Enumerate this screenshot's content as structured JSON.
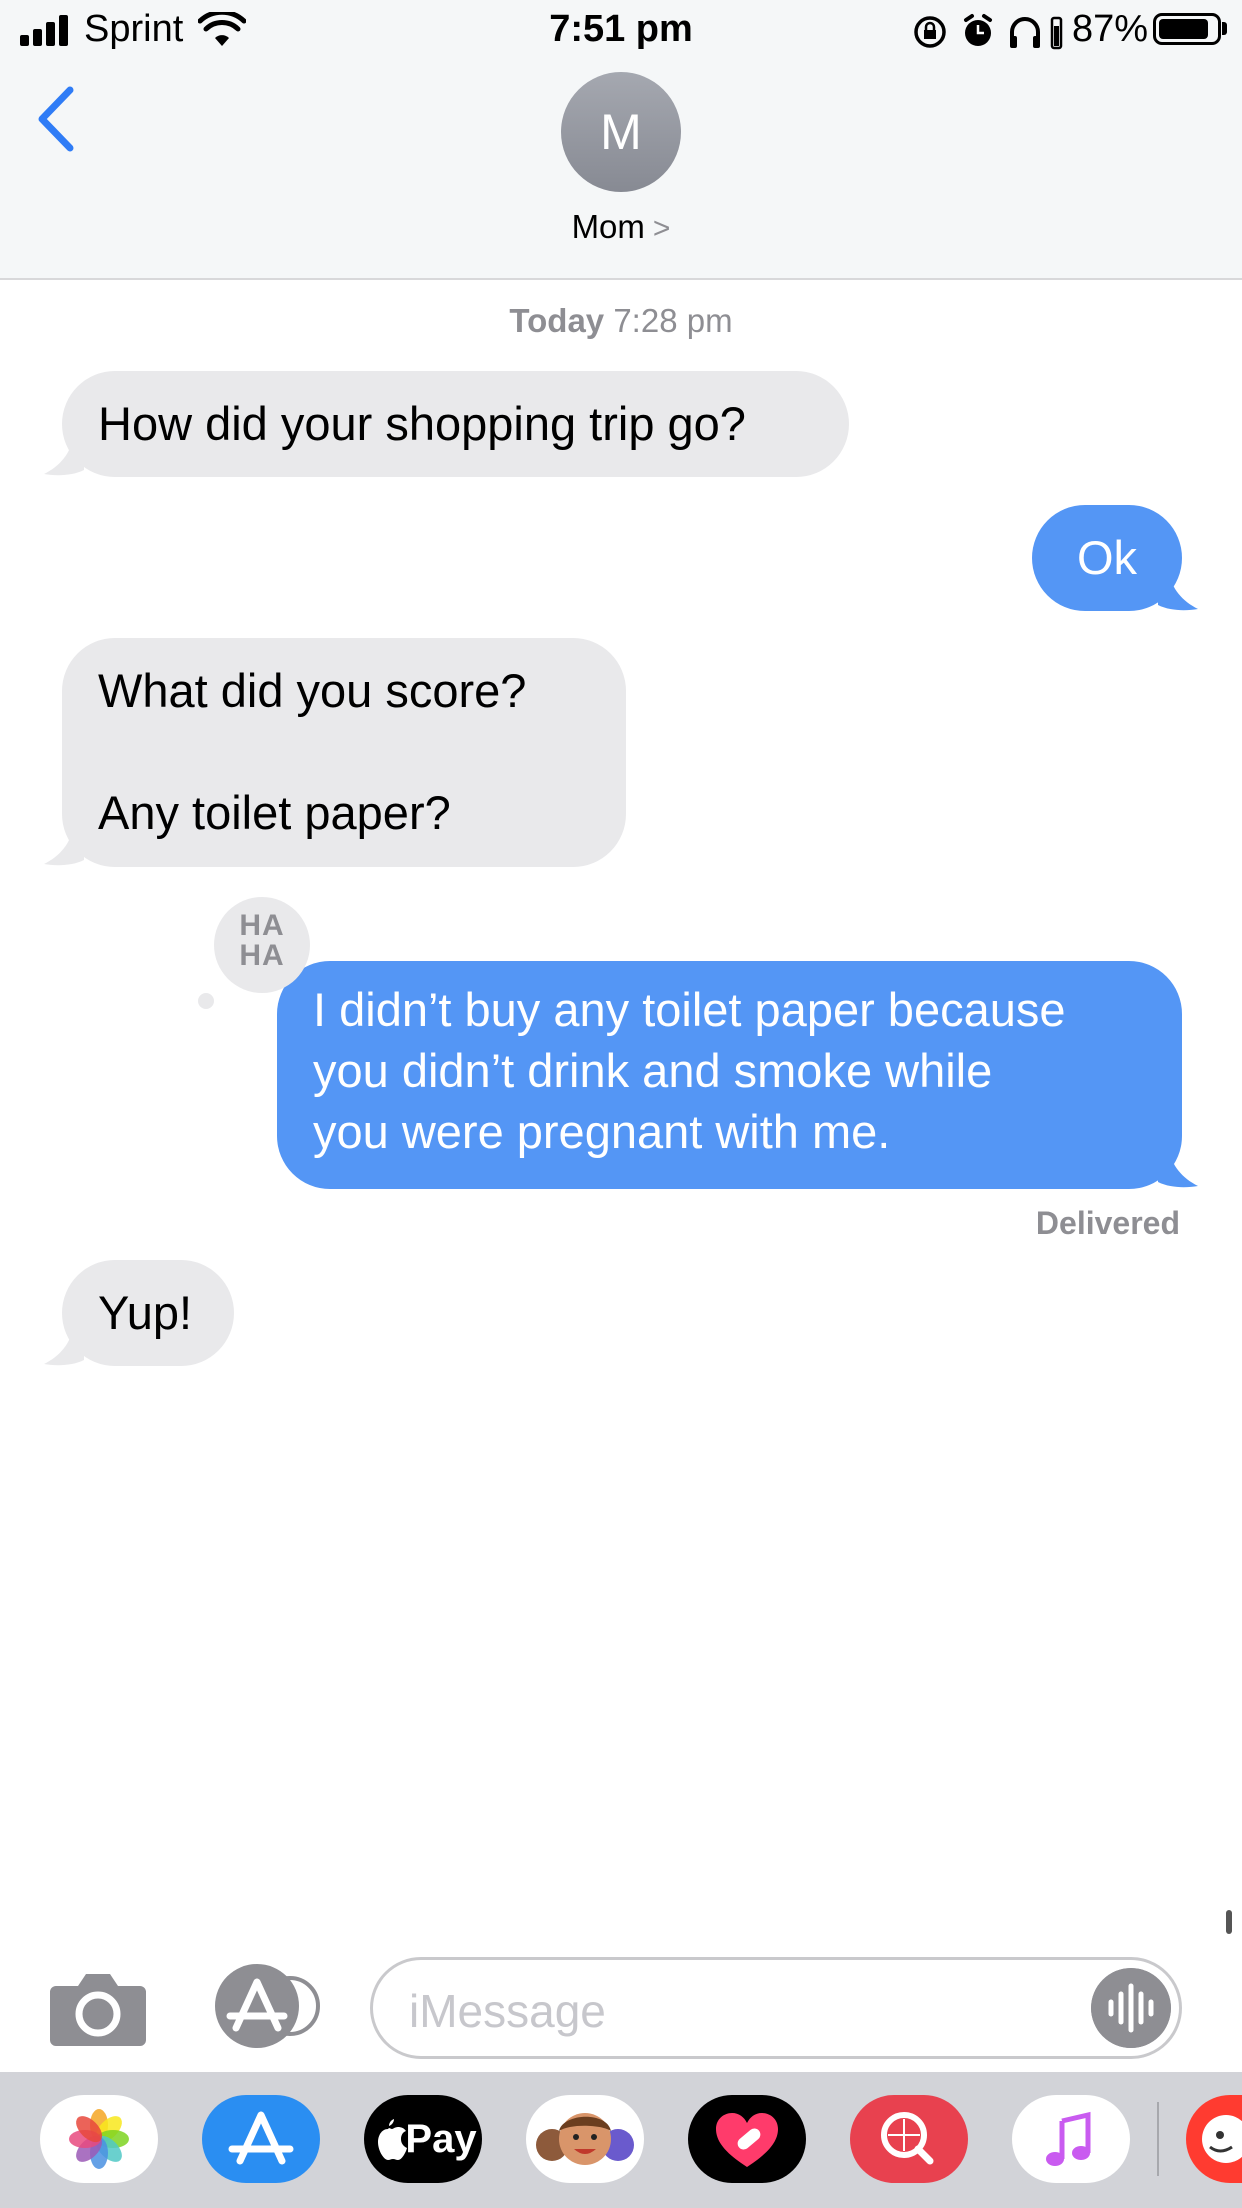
{
  "status_bar": {
    "carrier": "Sprint",
    "time": "7:51 pm",
    "battery_percent": "87%",
    "battery_level": 0.87,
    "icons": [
      "signal-icon",
      "wifi-icon",
      "rotation-lock-icon",
      "alarm-icon",
      "headphones-icon",
      "battery-icon"
    ]
  },
  "header": {
    "back_icon": "chevron-left-icon",
    "avatar_initial": "M",
    "contact_name": "Mom",
    "contact_chevron": ">"
  },
  "conversation": {
    "timestamp_day": "Today",
    "timestamp_time": "7:28 pm",
    "messages": [
      {
        "from": "received",
        "text": "How did your shopping trip go?"
      },
      {
        "from": "sent",
        "text": "Ok"
      },
      {
        "from": "received",
        "lines": [
          "What did you score?",
          "",
          "Any toilet paper?"
        ]
      },
      {
        "from": "sent",
        "lines": [
          "I didn’t buy any toilet paper because",
          "you didn’t drink and smoke while",
          "you were pregnant with me."
        ],
        "tapback": [
          "HA",
          "HA"
        ]
      },
      {
        "from": "received",
        "text": "Yup!"
      }
    ],
    "delivered_label": "Delivered"
  },
  "input_bar": {
    "placeholder": "iMessage",
    "camera_icon": "camera-icon",
    "apps_icon": "app-store-icon",
    "audio_icon": "audio-waveform-icon"
  },
  "app_drawer": {
    "apps": [
      "Photos",
      "App Store",
      "Apple Pay",
      "Memoji",
      "Digital Touch",
      "Images",
      "Music"
    ],
    "pay_label": "Pay"
  },
  "colors": {
    "sent_bubble": "#5496f5",
    "received_bubble": "#e9e9eb",
    "accent": "#2f7cf6",
    "header_bg": "#f5f7f8"
  }
}
